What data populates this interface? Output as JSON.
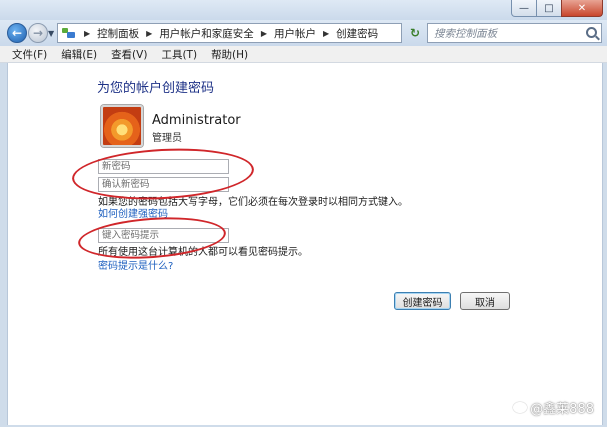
{
  "window": {
    "minimize_symbol": "—",
    "maximize_symbol": "□",
    "close_symbol": "✕"
  },
  "nav": {
    "back_symbol": "←",
    "forward_symbol": "→",
    "breadcrumbs": [
      "控制面板",
      "用户帐户和家庭安全",
      "用户帐户",
      "创建密码"
    ],
    "refresh_symbol": "↻",
    "search_placeholder": "搜索控制面板"
  },
  "menu": {
    "items": [
      "文件(F)",
      "编辑(E)",
      "查看(V)",
      "工具(T)",
      "帮助(H)"
    ]
  },
  "page": {
    "heading": "为您的帐户创建密码",
    "username": "Administrator",
    "user_type": "管理员",
    "new_password_placeholder": "新密码",
    "confirm_password_placeholder": "确认新密码",
    "case_note": "如果您的密码包括大写字母，它们必须在每次登录时以相同方式键入。",
    "strong_password_link": "如何创建强密码",
    "hint_placeholder": "键入密码提示",
    "hint_note": "所有使用这台计算机的人都可以看见密码提示。",
    "hint_link": "密码提示是什么?",
    "create_button": "创建密码",
    "cancel_button": "取消"
  },
  "watermark": {
    "text": "@鑫莱888"
  },
  "colors": {
    "heading": "#1e3287",
    "link": "#1d5fbf",
    "annotation_circle": "#d0262a"
  }
}
